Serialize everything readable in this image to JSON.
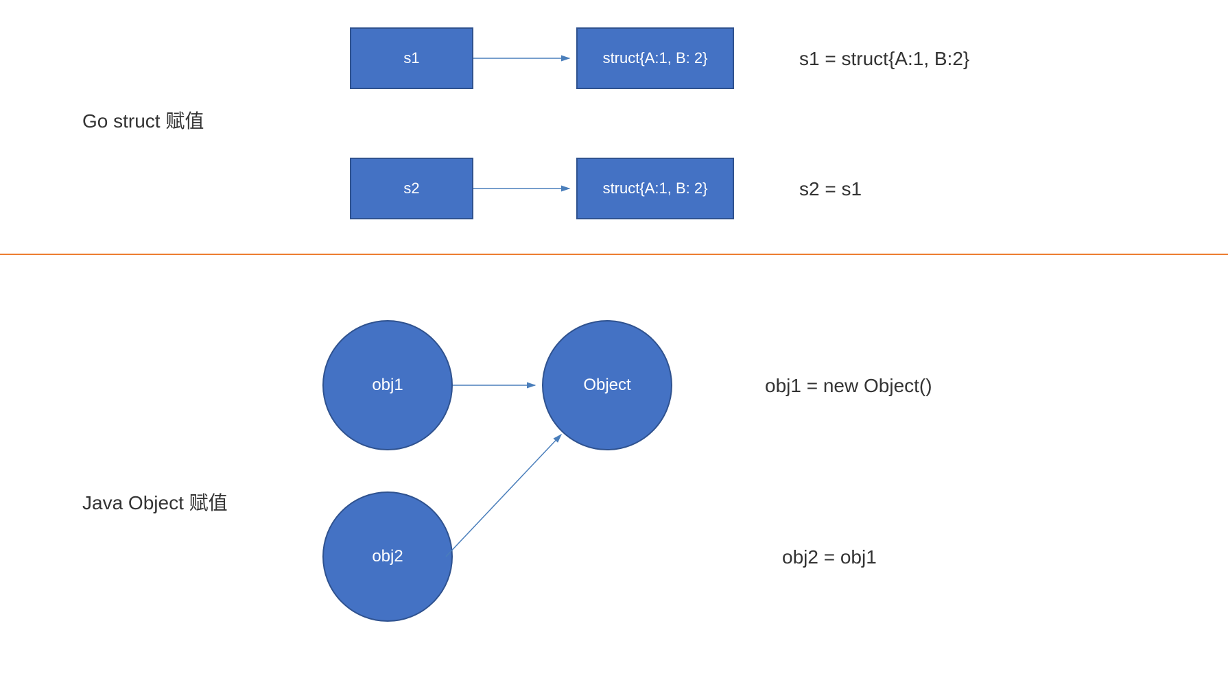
{
  "top": {
    "title": "Go struct 赋值",
    "s1": "s1",
    "s1_struct": "struct{A:1, B: 2}",
    "s1_code": "s1 = struct{A:1, B:2}",
    "s2": "s2",
    "s2_struct": "struct{A:1, B: 2}",
    "s2_code": "s2 = s1"
  },
  "bottom": {
    "title": "Java Object 赋值",
    "obj1": "obj1",
    "object": "Object",
    "obj1_code": "obj1 = new Object()",
    "obj2": "obj2",
    "obj2_code": "obj2 = obj1"
  },
  "colors": {
    "shape_fill": "#4472c4",
    "shape_border": "#2f528f",
    "divider": "#ed7d31",
    "arrow": "#4a7ebb"
  }
}
